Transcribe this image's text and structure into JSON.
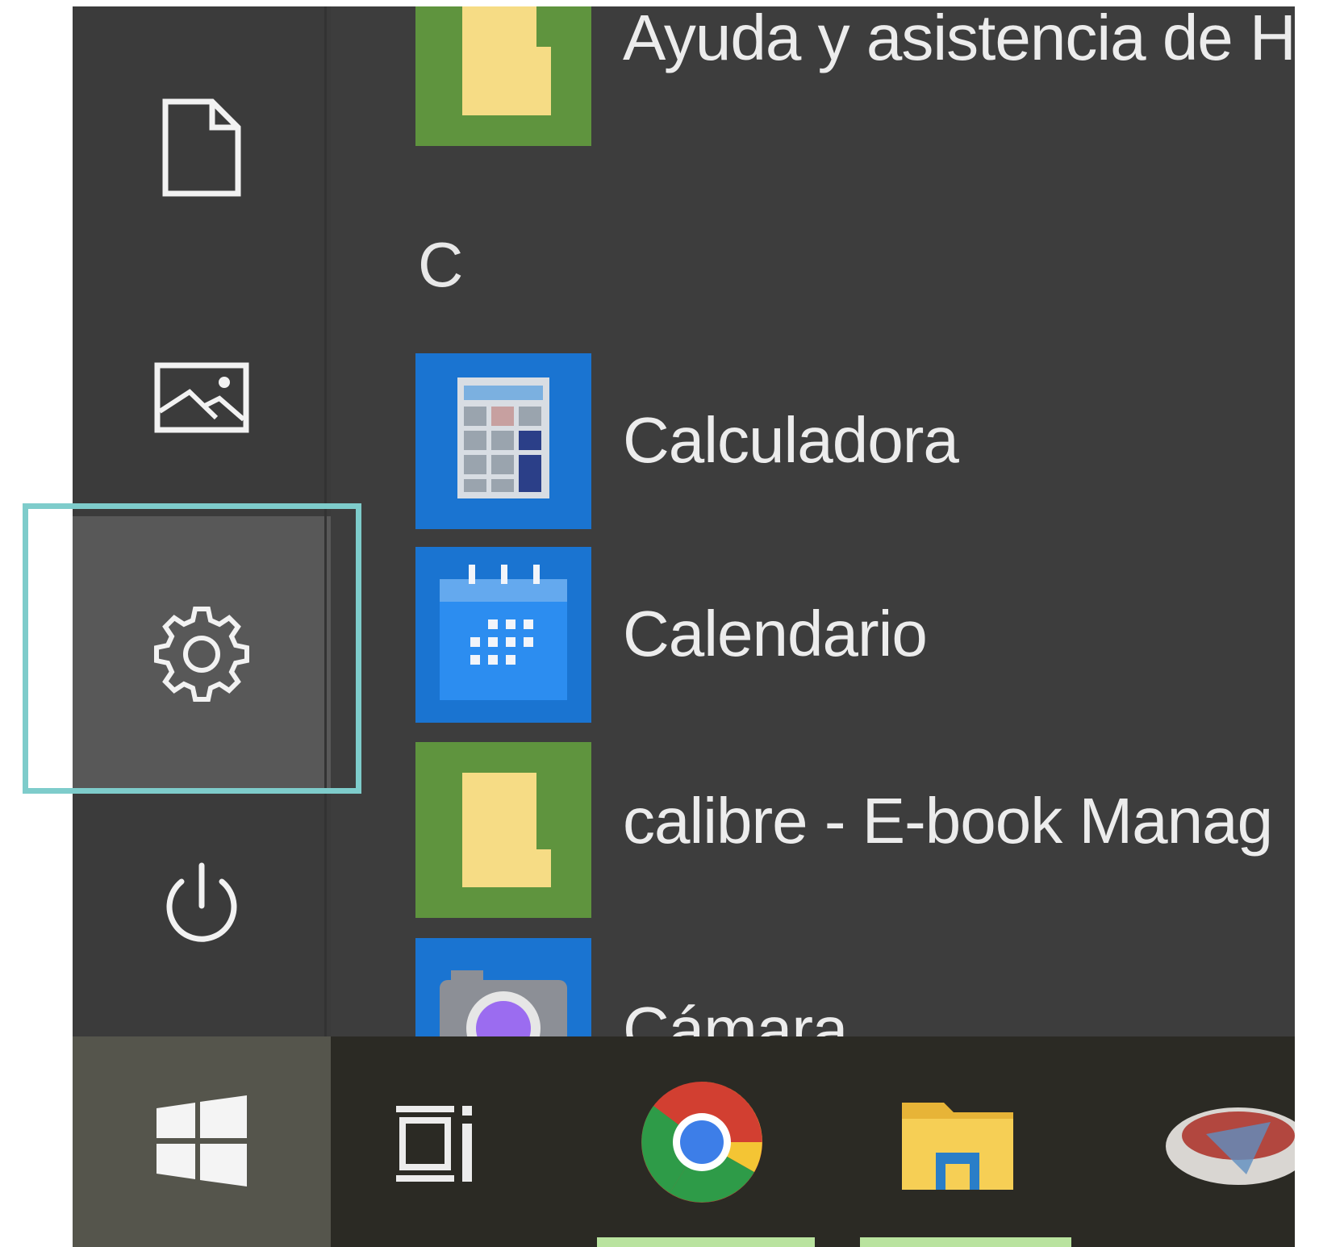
{
  "rail": {
    "items": [
      {
        "icon": "document-icon"
      },
      {
        "icon": "pictures-icon"
      },
      {
        "icon": "gear-icon",
        "highlighted": true
      },
      {
        "icon": "power-icon"
      }
    ]
  },
  "app_list": {
    "apps_top": {
      "label": "Ayuda y asistencia de H",
      "icon": "folder-tile-icon",
      "tile_color": "#5f943e"
    },
    "section": "C",
    "apps": [
      {
        "label": "Calculadora",
        "icon": "calculator-icon",
        "tile_color": "#1a74d1"
      },
      {
        "label": "Calendario",
        "icon": "calendar-icon",
        "tile_color": "#1a74d1"
      },
      {
        "label": "calibre - E-book Manag",
        "icon": "folder-tile-icon",
        "tile_color": "#5f943e"
      },
      {
        "label": "Cámara",
        "icon": "camera-icon",
        "tile_color": "#1a74d1"
      }
    ]
  },
  "taskbar": {
    "items": [
      {
        "icon": "windows-start-icon"
      },
      {
        "icon": "task-view-icon"
      },
      {
        "icon": "chrome-icon",
        "active": true
      },
      {
        "icon": "file-explorer-icon",
        "active": true
      },
      {
        "icon": "app-icon-partial"
      }
    ]
  },
  "colors": {
    "highlight_border": "#7ecccb",
    "tile_green": "#5f943e",
    "tile_blue": "#1a74d1",
    "taskbar_indicator": "#b9e39f"
  }
}
